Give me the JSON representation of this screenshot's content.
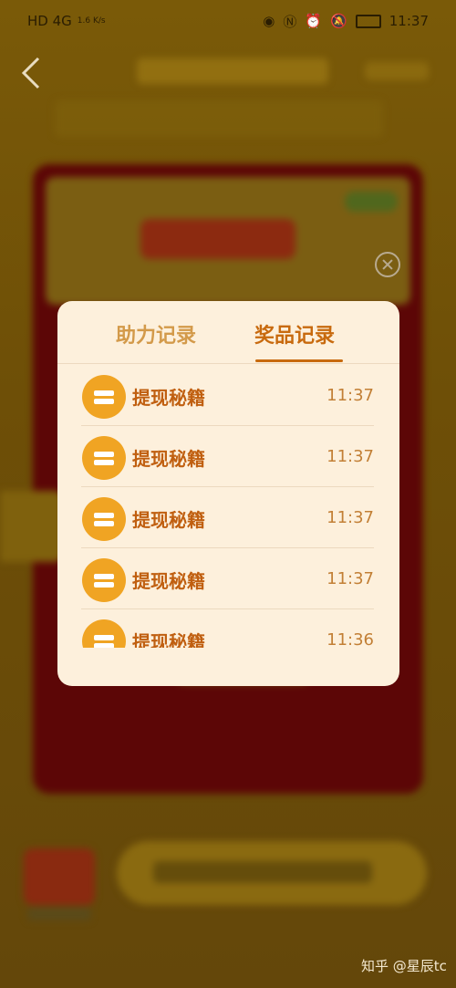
{
  "status_bar": {
    "left": "HD 4G",
    "data_speed": "1.6 K/s",
    "time": "11:37"
  },
  "modal": {
    "tabs": [
      {
        "label": "助力记录",
        "active": false
      },
      {
        "label": "奖品记录",
        "active": true
      }
    ],
    "records": [
      {
        "name": "提现秘籍",
        "time": "11:37",
        "icon": "coin-icon"
      },
      {
        "name": "提现秘籍",
        "time": "11:37",
        "icon": "coin-icon"
      },
      {
        "name": "提现秘籍",
        "time": "11:37",
        "icon": "coin-icon"
      },
      {
        "name": "提现秘籍",
        "time": "11:37",
        "icon": "coin-icon"
      },
      {
        "name": "提现秘籍",
        "time": "11:36",
        "icon": "coin-icon"
      }
    ]
  },
  "icons": {
    "back": "back-arrow-icon",
    "close": "close-icon"
  },
  "colors": {
    "modal_bg": "#fdf0dc",
    "active_tab": "#c86a0e",
    "inactive_tab": "#d39a4a",
    "coin": "#f0a423"
  },
  "watermark": "知乎 @星辰tc"
}
